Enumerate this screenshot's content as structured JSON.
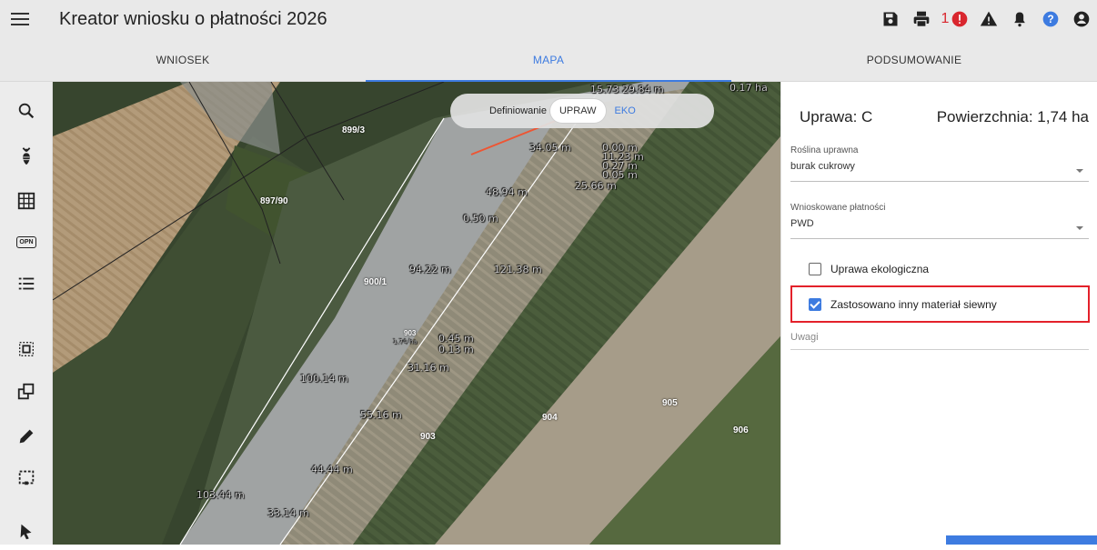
{
  "app": {
    "title": "Kreator wniosku o płatności 2026"
  },
  "topbar": {
    "icons": [
      "save-icon",
      "print-icon",
      "error-badge-icon",
      "warning-icon",
      "bell-icon",
      "help-icon",
      "account-icon"
    ],
    "error_count": "1"
  },
  "tabs": [
    {
      "label": "WNIOSEK"
    },
    {
      "label": "MAPA"
    },
    {
      "label": "PODSUMOWANIE"
    }
  ],
  "left_tools": [
    "search-icon",
    "plant-icon",
    "grid-icon",
    "opn-icon",
    "list-icon",
    "select-area-icon",
    "copy-shape-icon",
    "pencil-icon",
    "crop-icon",
    "pointer-icon"
  ],
  "left_tools_opn_label": "OPN",
  "map": {
    "toggle": {
      "label": "Definiowanie",
      "options": [
        "UPRAW",
        "EKO"
      ],
      "selected": "UPRAW"
    },
    "parcels": [
      "899/3",
      "897/90",
      "900/1",
      "903",
      "904",
      "905",
      "906",
      "903"
    ],
    "measures": [
      "34.05 m",
      "0.00 m",
      "11.23 m",
      "0.27 m",
      "0.05 m",
      "25.66 m",
      "48.94 m",
      "0.50 m",
      "94.22 m",
      "121.38 m",
      "0.45 m",
      "0.13 m",
      "31.16 m",
      "100.14 m",
      "55.16 m",
      "44.44 m",
      "103.44 m",
      "33.14 m",
      "15.73",
      "29.84 m",
      "0.17 ha",
      "1.74 ha"
    ]
  },
  "panel": {
    "crop_label": "Uprawa: C",
    "area_label": "Powierzchnia: 1,74 ha",
    "plant": {
      "label": "Roślina uprawna",
      "value": "burak cukrowy"
    },
    "payments": {
      "label": "Wnioskowane płatności",
      "value": "PWD"
    },
    "checkbox_eco": {
      "label": "Uprawa ekologiczna",
      "checked": false
    },
    "checkbox_seed": {
      "label": "Zastosowano inny materiał siewny",
      "checked": true
    },
    "notes_placeholder": "Uwagi"
  },
  "colors": {
    "accent": "#3d7be0",
    "highlight": "#e3212a",
    "error": "#d9262e"
  }
}
